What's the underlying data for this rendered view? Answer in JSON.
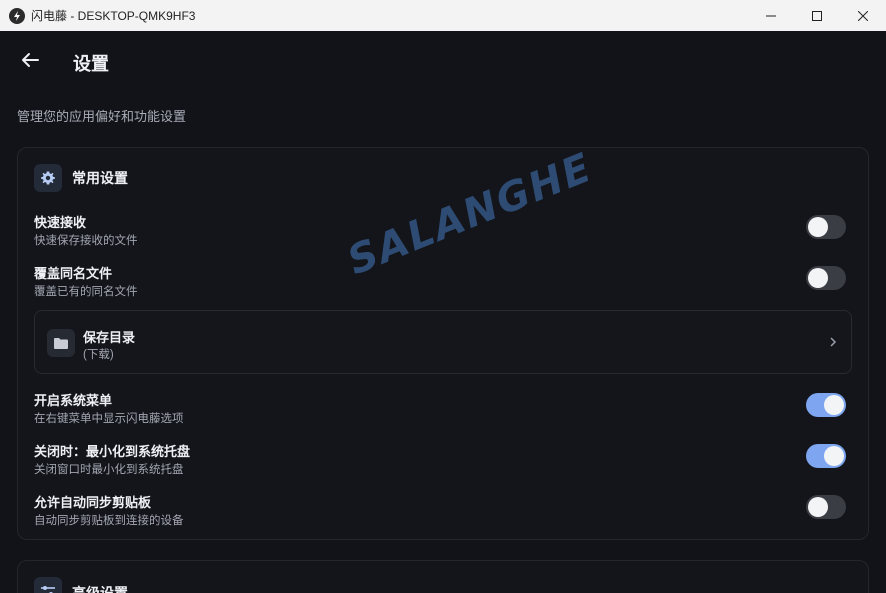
{
  "window": {
    "title": "闪电藤 - DESKTOP-QMK9HF3"
  },
  "header": {
    "title": "设置",
    "subtitle": "管理您的应用偏好和功能设置"
  },
  "common_settings": {
    "title": "常用设置",
    "rows": [
      {
        "title": "快速接收",
        "desc": "快速保存接收的文件",
        "enabled": false
      },
      {
        "title": "覆盖同名文件",
        "desc": "覆盖已有的同名文件",
        "enabled": false
      },
      {
        "title": "开启系统菜单",
        "desc": "在右键菜单中显示闪电藤选项",
        "enabled": true
      },
      {
        "title": "关闭时：最小化到系统托盘",
        "desc": "关闭窗口时最小化到系统托盘",
        "enabled": true
      },
      {
        "title": "允许自动同步剪贴板",
        "desc": "自动同步剪贴板到连接的设备",
        "enabled": false
      }
    ],
    "save_dir": {
      "title": "保存目录",
      "value": "(下载)"
    }
  },
  "advanced_settings": {
    "title": "高级设置"
  },
  "watermark": "SALANGHE",
  "colors": {
    "background": "#111318",
    "accent": "#7ea6f0"
  }
}
